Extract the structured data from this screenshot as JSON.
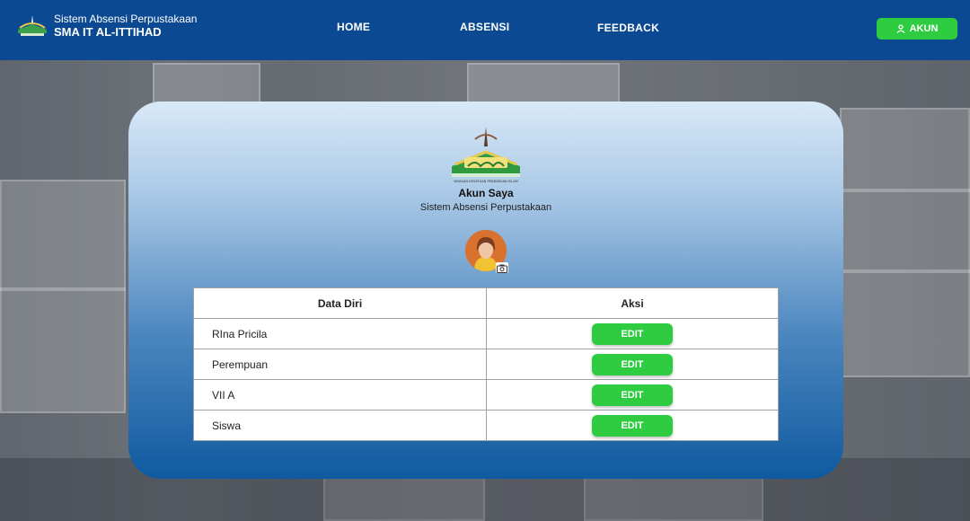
{
  "header": {
    "subtitle": "Sistem Absensi Perpustakaan",
    "title": "SMA IT AL-ITTIHAD",
    "nav": [
      "HOME",
      "ABSENSI",
      "FEEDBACK"
    ],
    "account_button": "AKUN"
  },
  "card": {
    "logo_text": "YAYASAN KESATUAN PENDIDIKAN ISLAM",
    "title": "Akun Saya",
    "subtitle": "Sistem Absensi Perpustakaan"
  },
  "table": {
    "headers": [
      "Data Diri",
      "Aksi"
    ],
    "rows": [
      {
        "value": "RIna Pricila",
        "action": "EDIT"
      },
      {
        "value": "Perempuan",
        "action": "EDIT"
      },
      {
        "value": "VII A",
        "action": "EDIT"
      },
      {
        "value": "Siswa",
        "action": "EDIT"
      }
    ]
  },
  "colors": {
    "header_bg": "#0b4a93",
    "accent_green": "#2ecc40",
    "card_top": "#d9e9f8",
    "card_bottom": "#0f5aa0"
  }
}
